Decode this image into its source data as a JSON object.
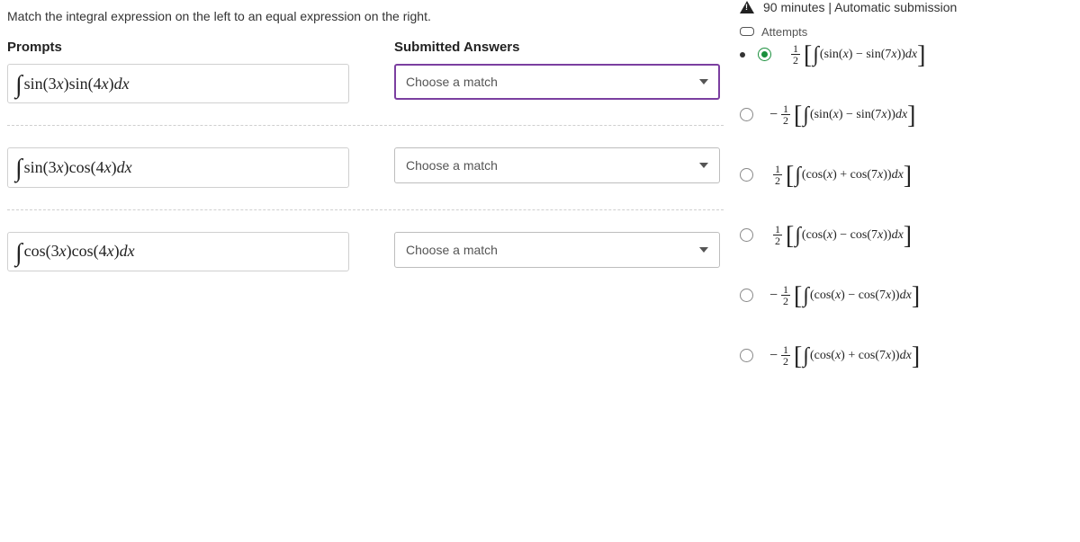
{
  "instruction": "Match the integral expression on the left to an equal expression on the right.",
  "headers": {
    "prompts": "Prompts",
    "answers": "Submitted Answers"
  },
  "prompts": [
    {
      "expr": "sin(3x)sin(4x)dx"
    },
    {
      "expr": "sin(3x)cos(4x)dx"
    },
    {
      "expr": "cos(3x)cos(4x)dx"
    }
  ],
  "answer_placeholder": "Choose a match",
  "timer": {
    "text": "90 minutes | Automatic submission"
  },
  "attempts_label": "Attempts",
  "options": [
    {
      "sign": "",
      "inner": "(sin(x) − sin(7x))dx",
      "selected": true
    },
    {
      "sign": "−",
      "inner": "(sin(x) − sin(7x))dx",
      "selected": false
    },
    {
      "sign": "",
      "inner": "(cos(x) + cos(7x))dx",
      "selected": false
    },
    {
      "sign": "",
      "inner": "(cos(x) − cos(7x))dx",
      "selected": false
    },
    {
      "sign": "−",
      "inner": "(cos(x) − cos(7x))dx",
      "selected": false
    },
    {
      "sign": "−",
      "inner": "(cos(x) + cos(7x))dx",
      "selected": false
    }
  ],
  "frac": {
    "num": "1",
    "den": "2"
  }
}
